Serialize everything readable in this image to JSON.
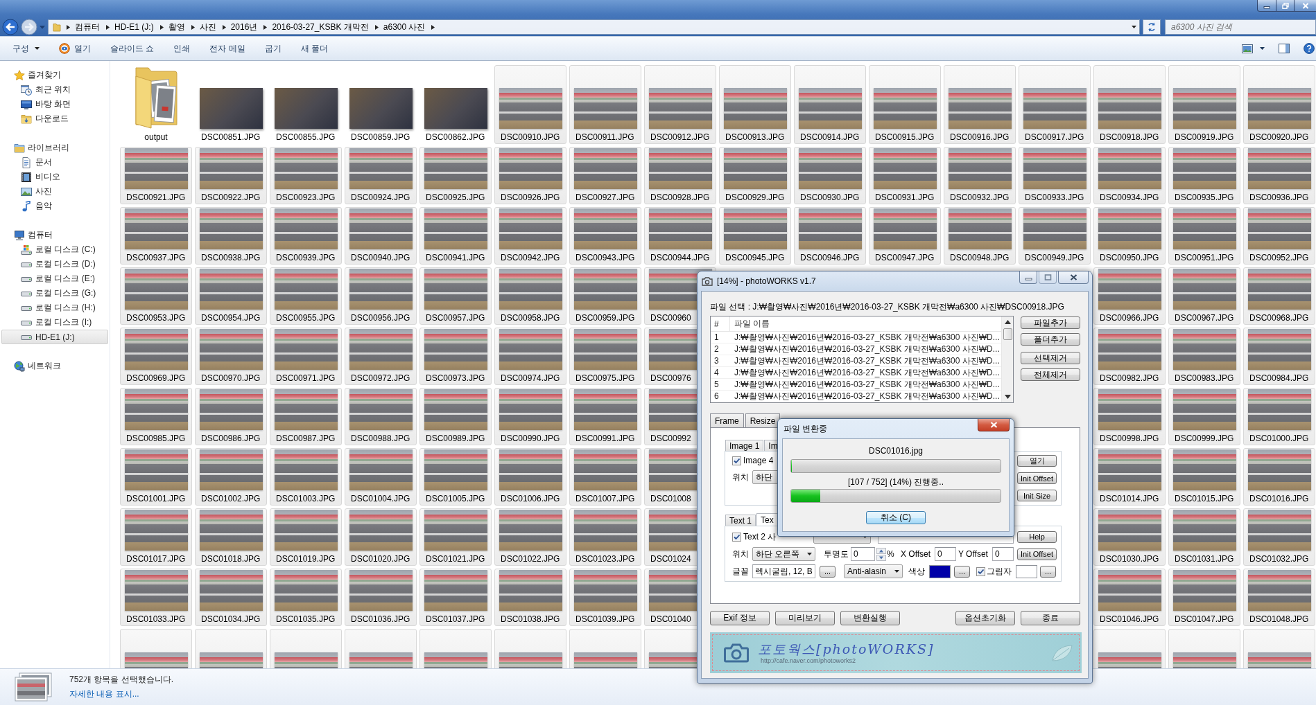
{
  "address_bar": {
    "path": [
      "컴퓨터",
      "HD-E1 (J:)",
      "촬영",
      "사진",
      "2016년",
      "2016-03-27_KSBK 개막전",
      "a6300 사진"
    ]
  },
  "search": {
    "placeholder": "a6300 사진 검색"
  },
  "toolbar": {
    "items": [
      {
        "label": "구성",
        "kind": "menu"
      },
      {
        "label": "열기",
        "kind": "viewer"
      },
      {
        "label": "슬라이드 쇼",
        "kind": "plain"
      },
      {
        "label": "인쇄",
        "kind": "plain"
      },
      {
        "label": "전자 메일",
        "kind": "plain"
      },
      {
        "label": "굽기",
        "kind": "plain"
      },
      {
        "label": "새 폴더",
        "kind": "plain"
      }
    ]
  },
  "sidebar": {
    "groups": [
      {
        "label": "즐겨찾기",
        "kind": "favorites",
        "selected": false,
        "children": [
          {
            "label": "최근 위치",
            "kind": "recent",
            "selected": false
          },
          {
            "label": "바탕 화면",
            "kind": "desktop",
            "selected": false
          },
          {
            "label": "다운로드",
            "kind": "downloads",
            "selected": false
          }
        ]
      },
      {
        "label": "라이브러리",
        "kind": "libraries",
        "selected": false,
        "children": [
          {
            "label": "문서",
            "kind": "documents",
            "selected": false
          },
          {
            "label": "비디오",
            "kind": "videos",
            "selected": false
          },
          {
            "label": "사진",
            "kind": "pictures",
            "selected": false
          },
          {
            "label": "음악",
            "kind": "music",
            "selected": false
          }
        ]
      },
      {
        "label": "컴퓨터",
        "kind": "computer",
        "selected": false,
        "children": [
          {
            "label": "로컬 디스크 (C:)",
            "kind": "system",
            "selected": false
          },
          {
            "label": "로컬 디스크 (D:)",
            "kind": "drive",
            "selected": false
          },
          {
            "label": "로컬 디스크 (E:)",
            "kind": "drive",
            "selected": false
          },
          {
            "label": "로컬 디스크 (G:)",
            "kind": "drive",
            "selected": false
          },
          {
            "label": "로컬 디스크 (H:)",
            "kind": "drive",
            "selected": false
          },
          {
            "label": "로컬 디스크 (I:)",
            "kind": "drive",
            "selected": false
          },
          {
            "label": "HD-E1 (J:)",
            "kind": "drive",
            "selected": true
          }
        ]
      },
      {
        "label": "네트워크",
        "kind": "network",
        "selected": false
      }
    ]
  },
  "files": {
    "rows": [
      [
        {
          "name": "output",
          "kind": "folder",
          "selected": false
        },
        {
          "name": "DSC00851.JPG",
          "kind": "photo",
          "selected": false
        },
        {
          "name": "DSC00855.JPG",
          "kind": "photo",
          "selected": false
        },
        {
          "name": "DSC00859.JPG",
          "kind": "photo",
          "selected": false
        },
        {
          "name": "DSC00862.JPG",
          "kind": "photo",
          "selected": false
        },
        {
          "name": "DSC00910.JPG",
          "kind": "race",
          "selected": true
        },
        {
          "name": "DSC00911.JPG",
          "kind": "race",
          "selected": true
        },
        {
          "name": "DSC00912.JPG",
          "kind": "race",
          "selected": true
        },
        {
          "name": "DSC00913.JPG",
          "kind": "race",
          "selected": true
        },
        {
          "name": "DSC00914.JPG",
          "kind": "race",
          "selected": true
        },
        {
          "name": "DSC00915.JPG",
          "kind": "race",
          "selected": true
        },
        {
          "name": "DSC00916.JPG",
          "kind": "race",
          "selected": true
        },
        {
          "name": "DSC00917.JPG",
          "kind": "race",
          "selected": true
        },
        {
          "name": "DSC00918.JPG",
          "kind": "race",
          "selected": true
        },
        {
          "name": "DSC00919.JPG",
          "kind": "race",
          "selected": true
        },
        {
          "name": "DSC00920.JPG",
          "kind": "race",
          "selected": true
        }
      ],
      [
        {
          "name": "DSC00921.JPG",
          "kind": "race",
          "selected": true
        },
        {
          "name": "DSC00922.JPG",
          "kind": "race",
          "selected": true
        },
        {
          "name": "DSC00923.JPG",
          "kind": "race",
          "selected": true
        },
        {
          "name": "DSC00924.JPG",
          "kind": "race",
          "selected": true
        },
        {
          "name": "DSC00925.JPG",
          "kind": "race",
          "selected": true
        },
        {
          "name": "DSC00926.JPG",
          "kind": "race",
          "selected": true
        },
        {
          "name": "DSC00927.JPG",
          "kind": "race",
          "selected": true
        },
        {
          "name": "DSC00928.JPG",
          "kind": "race",
          "selected": true
        },
        {
          "name": "DSC00929.JPG",
          "kind": "race",
          "selected": true
        },
        {
          "name": "DSC00930.JPG",
          "kind": "race",
          "selected": true
        },
        {
          "name": "DSC00931.JPG",
          "kind": "race",
          "selected": true
        },
        {
          "name": "DSC00932.JPG",
          "kind": "race",
          "selected": true
        },
        {
          "name": "DSC00933.JPG",
          "kind": "race",
          "selected": true
        },
        {
          "name": "DSC00934.JPG",
          "kind": "race",
          "selected": true
        },
        {
          "name": "DSC00935.JPG",
          "kind": "race",
          "selected": true
        },
        {
          "name": "DSC00936.JPG",
          "kind": "race",
          "selected": true
        }
      ],
      [
        {
          "name": "DSC00937.JPG",
          "kind": "race",
          "selected": true
        },
        {
          "name": "DSC00938.JPG",
          "kind": "race",
          "selected": true
        },
        {
          "name": "DSC00939.JPG",
          "kind": "race",
          "selected": true
        },
        {
          "name": "DSC00940.JPG",
          "kind": "race",
          "selected": true
        },
        {
          "name": "DSC00941.JPG",
          "kind": "race",
          "selected": true
        },
        {
          "name": "DSC00942.JPG",
          "kind": "race",
          "selected": true
        },
        {
          "name": "DSC00943.JPG",
          "kind": "race",
          "selected": true
        },
        {
          "name": "DSC00944.JPG",
          "kind": "race",
          "selected": true
        },
        {
          "name": "DSC00945.JPG",
          "kind": "race",
          "selected": true
        },
        {
          "name": "DSC00946.JPG",
          "kind": "race",
          "selected": true
        },
        {
          "name": "DSC00947.JPG",
          "kind": "race",
          "selected": true
        },
        {
          "name": "DSC00948.JPG",
          "kind": "race",
          "selected": true
        },
        {
          "name": "DSC00949.JPG",
          "kind": "race",
          "selected": true
        },
        {
          "name": "DSC00950.JPG",
          "kind": "race",
          "selected": true
        },
        {
          "name": "DSC00951.JPG",
          "kind": "race",
          "selected": true
        },
        {
          "name": "DSC00952.JPG",
          "kind": "race",
          "selected": true
        }
      ],
      [
        {
          "name": "DSC00953.JPG",
          "kind": "race",
          "selected": true
        },
        {
          "name": "DSC00954.JPG",
          "kind": "race",
          "selected": true
        },
        {
          "name": "DSC00955.JPG",
          "kind": "race",
          "selected": true
        },
        {
          "name": "DSC00956.JPG",
          "kind": "race",
          "selected": true
        },
        {
          "name": "DSC00957.JPG",
          "kind": "race",
          "selected": true
        },
        {
          "name": "DSC00958.JPG",
          "kind": "race",
          "selected": true
        },
        {
          "name": "DSC00959.JPG",
          "kind": "race",
          "selected": true
        },
        {
          "name": "DSC00960",
          "kind": "race",
          "selected": true
        },
        null,
        null,
        null,
        null,
        null,
        {
          "name": "DSC00966.JPG",
          "kind": "race",
          "selected": true
        },
        {
          "name": "DSC00967.JPG",
          "kind": "race",
          "selected": true
        },
        {
          "name": "DSC00968.JPG",
          "kind": "race",
          "selected": true
        }
      ],
      [
        {
          "name": "DSC00969.JPG",
          "kind": "race",
          "selected": true
        },
        {
          "name": "DSC00970.JPG",
          "kind": "race",
          "selected": true
        },
        {
          "name": "DSC00971.JPG",
          "kind": "race",
          "selected": true
        },
        {
          "name": "DSC00972.JPG",
          "kind": "race",
          "selected": true
        },
        {
          "name": "DSC00973.JPG",
          "kind": "race",
          "selected": true
        },
        {
          "name": "DSC00974.JPG",
          "kind": "race",
          "selected": true
        },
        {
          "name": "DSC00975.JPG",
          "kind": "race",
          "selected": true
        },
        {
          "name": "DSC00976",
          "kind": "race",
          "selected": true
        },
        null,
        null,
        null,
        null,
        null,
        {
          "name": "DSC00982.JPG",
          "kind": "race",
          "selected": true
        },
        {
          "name": "DSC00983.JPG",
          "kind": "race",
          "selected": true
        },
        {
          "name": "DSC00984.JPG",
          "kind": "race",
          "selected": true
        }
      ],
      [
        {
          "name": "DSC00985.JPG",
          "kind": "race",
          "selected": true
        },
        {
          "name": "DSC00986.JPG",
          "kind": "race",
          "selected": true
        },
        {
          "name": "DSC00987.JPG",
          "kind": "race",
          "selected": true
        },
        {
          "name": "DSC00988.JPG",
          "kind": "race",
          "selected": true
        },
        {
          "name": "DSC00989.JPG",
          "kind": "race",
          "selected": true
        },
        {
          "name": "DSC00990.JPG",
          "kind": "race",
          "selected": true
        },
        {
          "name": "DSC00991.JPG",
          "kind": "race",
          "selected": true
        },
        {
          "name": "DSC00992",
          "kind": "race",
          "selected": true
        },
        null,
        null,
        null,
        null,
        null,
        {
          "name": "DSC00998.JPG",
          "kind": "race",
          "selected": true
        },
        {
          "name": "DSC00999.JPG",
          "kind": "race",
          "selected": true
        },
        {
          "name": "DSC01000.JPG",
          "kind": "race",
          "selected": true
        }
      ],
      [
        {
          "name": "DSC01001.JPG",
          "kind": "race",
          "selected": true
        },
        {
          "name": "DSC01002.JPG",
          "kind": "race",
          "selected": true
        },
        {
          "name": "DSC01003.JPG",
          "kind": "race",
          "selected": true
        },
        {
          "name": "DSC01004.JPG",
          "kind": "race",
          "selected": true
        },
        {
          "name": "DSC01005.JPG",
          "kind": "race",
          "selected": true
        },
        {
          "name": "DSC01006.JPG",
          "kind": "race",
          "selected": true
        },
        {
          "name": "DSC01007.JPG",
          "kind": "race",
          "selected": true
        },
        {
          "name": "DSC01008",
          "kind": "race",
          "selected": true
        },
        null,
        null,
        null,
        null,
        null,
        {
          "name": "DSC01014.JPG",
          "kind": "race",
          "selected": true
        },
        {
          "name": "DSC01015.JPG",
          "kind": "race",
          "selected": true
        },
        {
          "name": "DSC01016.JPG",
          "kind": "race",
          "selected": true
        }
      ],
      [
        {
          "name": "DSC01017.JPG",
          "kind": "race",
          "selected": true
        },
        {
          "name": "DSC01018.JPG",
          "kind": "race",
          "selected": true
        },
        {
          "name": "DSC01019.JPG",
          "kind": "race",
          "selected": true
        },
        {
          "name": "DSC01020.JPG",
          "kind": "race",
          "selected": true
        },
        {
          "name": "DSC01021.JPG",
          "kind": "race",
          "selected": true
        },
        {
          "name": "DSC01022.JPG",
          "kind": "race",
          "selected": true
        },
        {
          "name": "DSC01023.JPG",
          "kind": "race",
          "selected": true
        },
        {
          "name": "DSC01024",
          "kind": "race",
          "selected": true
        },
        null,
        null,
        null,
        null,
        null,
        {
          "name": "DSC01030.JPG",
          "kind": "race",
          "selected": true
        },
        {
          "name": "DSC01031.JPG",
          "kind": "race",
          "selected": true
        },
        {
          "name": "DSC01032.JPG",
          "kind": "race",
          "selected": true
        }
      ],
      [
        {
          "name": "DSC01033.JPG",
          "kind": "race",
          "selected": true
        },
        {
          "name": "DSC01034.JPG",
          "kind": "race",
          "selected": true
        },
        {
          "name": "DSC01035.JPG",
          "kind": "race",
          "selected": true
        },
        {
          "name": "DSC01036.JPG",
          "kind": "race",
          "selected": true
        },
        {
          "name": "DSC01037.JPG",
          "kind": "race",
          "selected": true
        },
        {
          "name": "DSC01038.JPG",
          "kind": "race",
          "selected": true
        },
        {
          "name": "DSC01039.JPG",
          "kind": "race",
          "selected": true
        },
        {
          "name": "DSC01040",
          "kind": "race",
          "selected": true
        },
        null,
        null,
        null,
        null,
        null,
        {
          "name": "DSC01046.JPG",
          "kind": "race",
          "selected": true
        },
        {
          "name": "DSC01047.JPG",
          "kind": "race",
          "selected": true
        },
        {
          "name": "DSC01048.JPG",
          "kind": "race",
          "selected": true
        }
      ],
      [
        {
          "kind": "race",
          "selected": true
        },
        {
          "kind": "race",
          "selected": true
        },
        {
          "kind": "race",
          "selected": true
        },
        {
          "kind": "race",
          "selected": true
        },
        {
          "kind": "race",
          "selected": true
        },
        {
          "kind": "race",
          "selected": true
        },
        {
          "kind": "race",
          "selected": true
        },
        {
          "kind": "race",
          "selected": true
        },
        null,
        null,
        null,
        null,
        null,
        {
          "kind": "race",
          "selected": true
        },
        {
          "kind": "race",
          "selected": true
        },
        {
          "kind": "race",
          "selected": true
        }
      ]
    ]
  },
  "status_bar": {
    "summary": "752개 항목을 선택했습니다.",
    "details_link": "자세한 내용 표시..."
  },
  "photoworks": {
    "title": "[14%] - photoWORKS v1.7",
    "file_selection": "파일 선택 : J:₩촬영₩사진₩2016년₩2016-03-27_KSBK 개막전₩a6300 사진₩DSC00918.JPG",
    "file_list": {
      "columns": [
        "#",
        "파일 이름"
      ],
      "rows": [
        [
          "1",
          "J:₩촬영₩사진₩2016년₩2016-03-27_KSBK 개막전₩a6300 사진₩D..."
        ],
        [
          "2",
          "J:₩촬영₩사진₩2016년₩2016-03-27_KSBK 개막전₩a6300 사진₩D..."
        ],
        [
          "3",
          "J:₩촬영₩사진₩2016년₩2016-03-27_KSBK 개막전₩a6300 사진₩D..."
        ],
        [
          "4",
          "J:₩촬영₩사진₩2016년₩2016-03-27_KSBK 개막전₩a6300 사진₩D..."
        ],
        [
          "5",
          "J:₩촬영₩사진₩2016년₩2016-03-27_KSBK 개막전₩a6300 사진₩D..."
        ],
        [
          "6",
          "J:₩촬영₩사진₩2016년₩2016-03-27_KSBK 개막전₩a6300 사진₩D..."
        ]
      ]
    },
    "list_buttons": [
      "파일추가",
      "폴더추가",
      "선택제거",
      "전체제거"
    ],
    "tabs": [
      {
        "label": "Frame",
        "selected": false
      },
      {
        "label": "Resize",
        "selected": false
      }
    ],
    "image_tabs": [
      {
        "label": "Image 1",
        "selected": false
      },
      {
        "label": "Im",
        "selected": false
      }
    ],
    "image_settings": {
      "enable": {
        "label": "Image 4",
        "checked": true
      },
      "position": {
        "label": "위치",
        "value": "하단"
      },
      "buttons": [
        "열기",
        "Init Offset",
        "Init Size"
      ]
    },
    "text_tabs": [
      {
        "label": "Text 1",
        "selected": false
      },
      {
        "label": "Tex",
        "selected": true
      }
    ],
    "text_settings": {
      "enable": {
        "label": "Text 2 사",
        "checked": true
      },
      "help_button": "Help",
      "position": {
        "label": "위치",
        "value": "하단 오른쪽"
      },
      "opacity": {
        "label": "투명도",
        "value": "0",
        "unit": "%"
      },
      "x_offset": {
        "label": "X Offset",
        "value": "0"
      },
      "y_offset": {
        "label": "Y Offset",
        "value": "0"
      },
      "init_offset_button": "Init Offset",
      "font": {
        "label": "글꼴",
        "value": "렉시굴림, 12, B",
        "button": "..."
      },
      "smoothing": {
        "value": "Anti-alasin"
      },
      "color": {
        "label": "색상",
        "color": "#0000a8",
        "button": "..."
      },
      "shadow": {
        "label": "그림자",
        "checked": true,
        "color": "#ffffff",
        "button": "..."
      }
    },
    "bottom_buttons": [
      "Exif 정보",
      "미리보기",
      "변환실행",
      "옵션초기화",
      "종료"
    ],
    "banner": {
      "title": "포토웍스[photoWORKS]",
      "url": "http://cafe.naver.com/photoworks2"
    }
  },
  "progress_dialog": {
    "title": "파일 변환중",
    "file": "DSC01016.jpg",
    "file_progress": {
      "level": 0
    },
    "status": "[107 / 752] (14%) 진행중..",
    "total_progress": {
      "level": 0.14
    },
    "cancel_button": "취소 (C)"
  }
}
